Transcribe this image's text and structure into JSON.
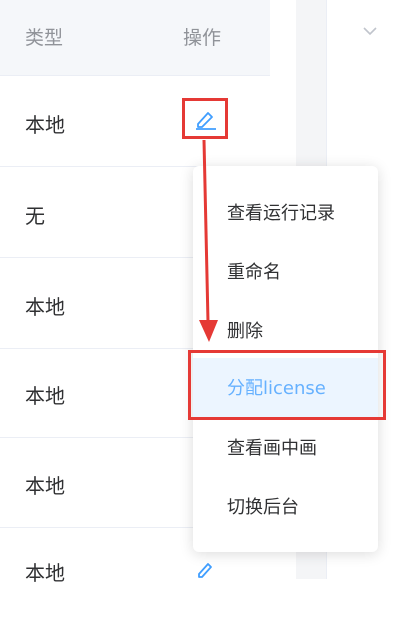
{
  "table": {
    "headers": {
      "type": "类型",
      "actions": "操作"
    },
    "rows": [
      {
        "type": "本地"
      },
      {
        "type": "无"
      },
      {
        "type": "本地"
      },
      {
        "type": "本地"
      },
      {
        "type": "本地"
      },
      {
        "type": "本地"
      }
    ]
  },
  "menu": {
    "items": [
      {
        "label": "查看运行记录"
      },
      {
        "label": "重命名"
      },
      {
        "label": "删除"
      },
      {
        "label": "分配license",
        "active": true
      },
      {
        "label": "查看画中画"
      },
      {
        "label": "切换后台"
      }
    ]
  },
  "icons": {
    "edit": "edit-icon",
    "dropdown": "chevron-down-icon"
  },
  "colors": {
    "accent": "#409eff",
    "active_bg": "#ecf5ff",
    "active_text": "#66b1ff",
    "annotation": "#e53935"
  }
}
